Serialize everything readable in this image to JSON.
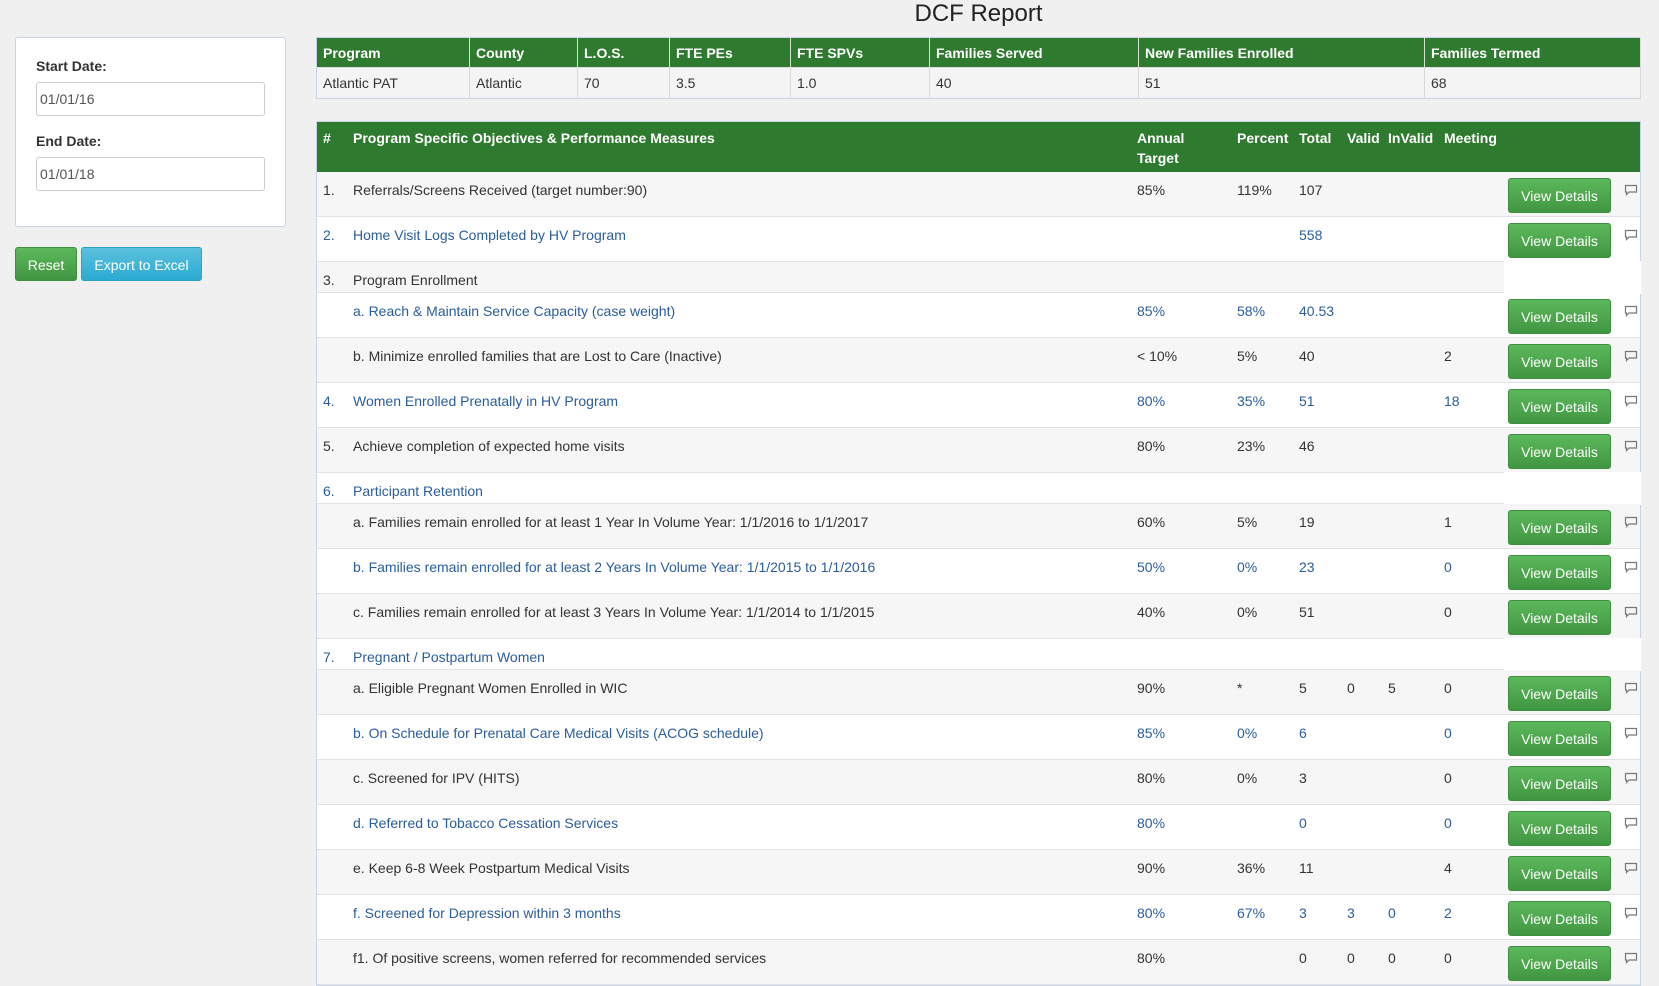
{
  "page_title": "DCF Report",
  "filters": {
    "start_label": "Start Date:",
    "start_value": "01/01/16",
    "end_label": "End Date:",
    "end_value": "01/01/18"
  },
  "actions": {
    "reset_label": "Reset",
    "export_label": "Export to Excel"
  },
  "summary": {
    "headers": [
      "Program",
      "County",
      "L.O.S.",
      "FTE PEs",
      "FTE SPVs",
      "Families Served",
      "New Families Enrolled",
      "Families Termed"
    ],
    "row": [
      "Atlantic PAT",
      "Atlantic",
      "70",
      "3.5",
      "1.0",
      "40",
      "51",
      "68"
    ]
  },
  "measures": {
    "headers": {
      "num": "#",
      "desc": "Program Specific Objectives & Performance Measures",
      "annual": "Annual Target",
      "percent": "Percent",
      "total": "Total",
      "valid": "Valid",
      "invalid": "InValid",
      "meeting": "Meeting"
    },
    "button_label": "View Details",
    "rows": [
      {
        "num": "1.",
        "desc": "Referrals/Screens Received (target number:90)",
        "annual": "85%",
        "percent": "119%",
        "total": "107",
        "valid": "",
        "invalid": "",
        "meeting": ""
      },
      {
        "num": "2.",
        "desc": "Home Visit Logs Completed by HV Program",
        "annual": "",
        "percent": "",
        "total": "558",
        "valid": "",
        "invalid": "",
        "meeting": ""
      },
      {
        "num": "3.",
        "desc": "Program Enrollment"
      },
      {
        "num": "",
        "desc": "a. Reach & Maintain Service Capacity (case weight)",
        "annual": "85%",
        "percent": "58%",
        "total": "40.53",
        "valid": "",
        "invalid": "",
        "meeting": ""
      },
      {
        "num": "",
        "desc": "b. Minimize enrolled families that are Lost to Care (Inactive)",
        "annual": "< 10%",
        "percent": "5%",
        "total": "40",
        "valid": "",
        "invalid": "",
        "meeting": "2"
      },
      {
        "num": "4.",
        "desc": "Women Enrolled Prenatally in HV Program",
        "annual": "80%",
        "percent": "35%",
        "total": "51",
        "valid": "",
        "invalid": "",
        "meeting": "18"
      },
      {
        "num": "5.",
        "desc": "Achieve completion of expected home visits",
        "annual": "80%",
        "percent": "23%",
        "total": "46",
        "valid": "",
        "invalid": "",
        "meeting": ""
      },
      {
        "num": "6.",
        "desc": "Participant Retention"
      },
      {
        "num": "",
        "desc": "a. Families remain enrolled for at least 1 Year In Volume Year: 1/1/2016 to 1/1/2017",
        "annual": "60%",
        "percent": "5%",
        "total": "19",
        "valid": "",
        "invalid": "",
        "meeting": "1"
      },
      {
        "num": "",
        "desc": "b. Families remain enrolled for at least 2 Years In Volume Year: 1/1/2015 to 1/1/2016",
        "annual": "50%",
        "percent": "0%",
        "total": "23",
        "valid": "",
        "invalid": "",
        "meeting": "0"
      },
      {
        "num": "",
        "desc": "c. Families remain enrolled for at least 3 Years In Volume Year: 1/1/2014 to 1/1/2015",
        "annual": "40%",
        "percent": "0%",
        "total": "51",
        "valid": "",
        "invalid": "",
        "meeting": "0"
      },
      {
        "num": "7.",
        "desc": "Pregnant / Postpartum Women"
      },
      {
        "num": "",
        "desc": "a. Eligible Pregnant Women Enrolled in WIC",
        "annual": "90%",
        "percent": "*",
        "total": "5",
        "valid": "0",
        "invalid": "5",
        "meeting": "0"
      },
      {
        "num": "",
        "desc": "b. On Schedule for Prenatal Care Medical Visits (ACOG schedule)",
        "annual": "85%",
        "percent": "0%",
        "total": "6",
        "valid": "",
        "invalid": "",
        "meeting": "0"
      },
      {
        "num": "",
        "desc": "c. Screened for IPV (HITS)",
        "annual": "80%",
        "percent": "0%",
        "total": "3",
        "valid": "",
        "invalid": "",
        "meeting": "0"
      },
      {
        "num": "",
        "desc": "d. Referred to Tobacco Cessation Services",
        "annual": "80%",
        "percent": "",
        "total": "0",
        "valid": "",
        "invalid": "",
        "meeting": "0"
      },
      {
        "num": "",
        "desc": "e. Keep 6-8 Week Postpartum Medical Visits",
        "annual": "90%",
        "percent": "36%",
        "total": "11",
        "valid": "",
        "invalid": "",
        "meeting": "4"
      },
      {
        "num": "",
        "desc": "f. Screened for Depression within 3 months",
        "annual": "80%",
        "percent": "67%",
        "total": "3",
        "valid": "3",
        "invalid": "0",
        "meeting": "2"
      },
      {
        "num": "",
        "desc": "f1. Of positive screens, women referred for recommended services",
        "annual": "80%",
        "percent": "",
        "total": "0",
        "valid": "0",
        "invalid": "0",
        "meeting": "0"
      }
    ]
  },
  "colors": {
    "header_green": "#2e7a2f",
    "button_green": "#4cae4c",
    "button_blue": "#39b3d7",
    "link_blue": "#2a5d9c"
  }
}
